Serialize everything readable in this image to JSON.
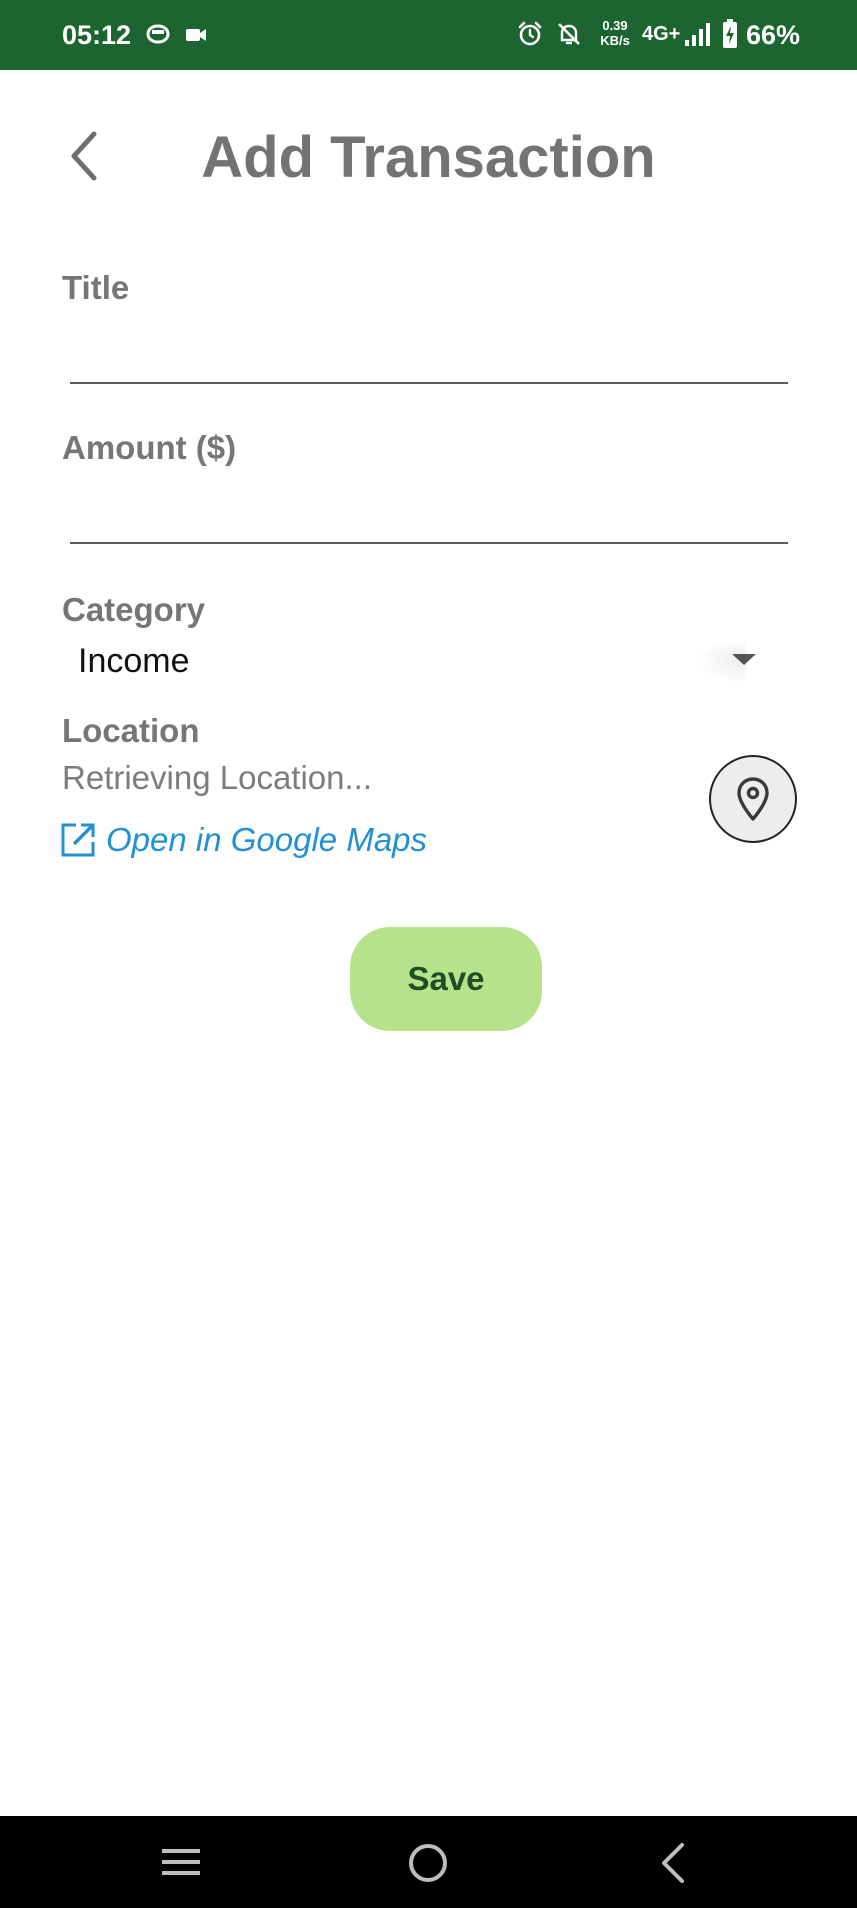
{
  "status_bar": {
    "time": "05:12",
    "left_icons": [
      "chat-bubble-icon",
      "video-camera-icon"
    ],
    "right_icons": [
      "alarm-icon",
      "notifications-off-icon",
      "signal-icon",
      "battery-charging-icon"
    ],
    "net_speed_value": "0.39",
    "net_speed_unit": "KB/s",
    "network_type": "4G+",
    "battery_percent": "66%",
    "background_color": "#1c6530"
  },
  "header": {
    "back_icon": "chevron-left-icon",
    "title": "Add Transaction"
  },
  "form": {
    "title_field": {
      "label": "Title",
      "value": "",
      "placeholder": ""
    },
    "amount_field": {
      "label": "Amount ($)",
      "value": "",
      "placeholder": ""
    },
    "category_field": {
      "label": "Category",
      "selected": "Income",
      "icon": "dropdown-arrow-icon"
    },
    "location_field": {
      "label": "Location",
      "status": "Retrieving Location...",
      "link_icon": "external-link-icon",
      "link_text": "Open in Google Maps",
      "button_icon": "map-pin-icon"
    },
    "save_label": "Save"
  },
  "colors": {
    "accent_green": "#b5e28a",
    "save_text": "#1f4d24",
    "link_blue": "#2390d6",
    "label_gray": "#767676"
  },
  "nav_bar": {
    "icons": [
      "menu-icon",
      "home-circle-icon",
      "back-icon"
    ]
  }
}
